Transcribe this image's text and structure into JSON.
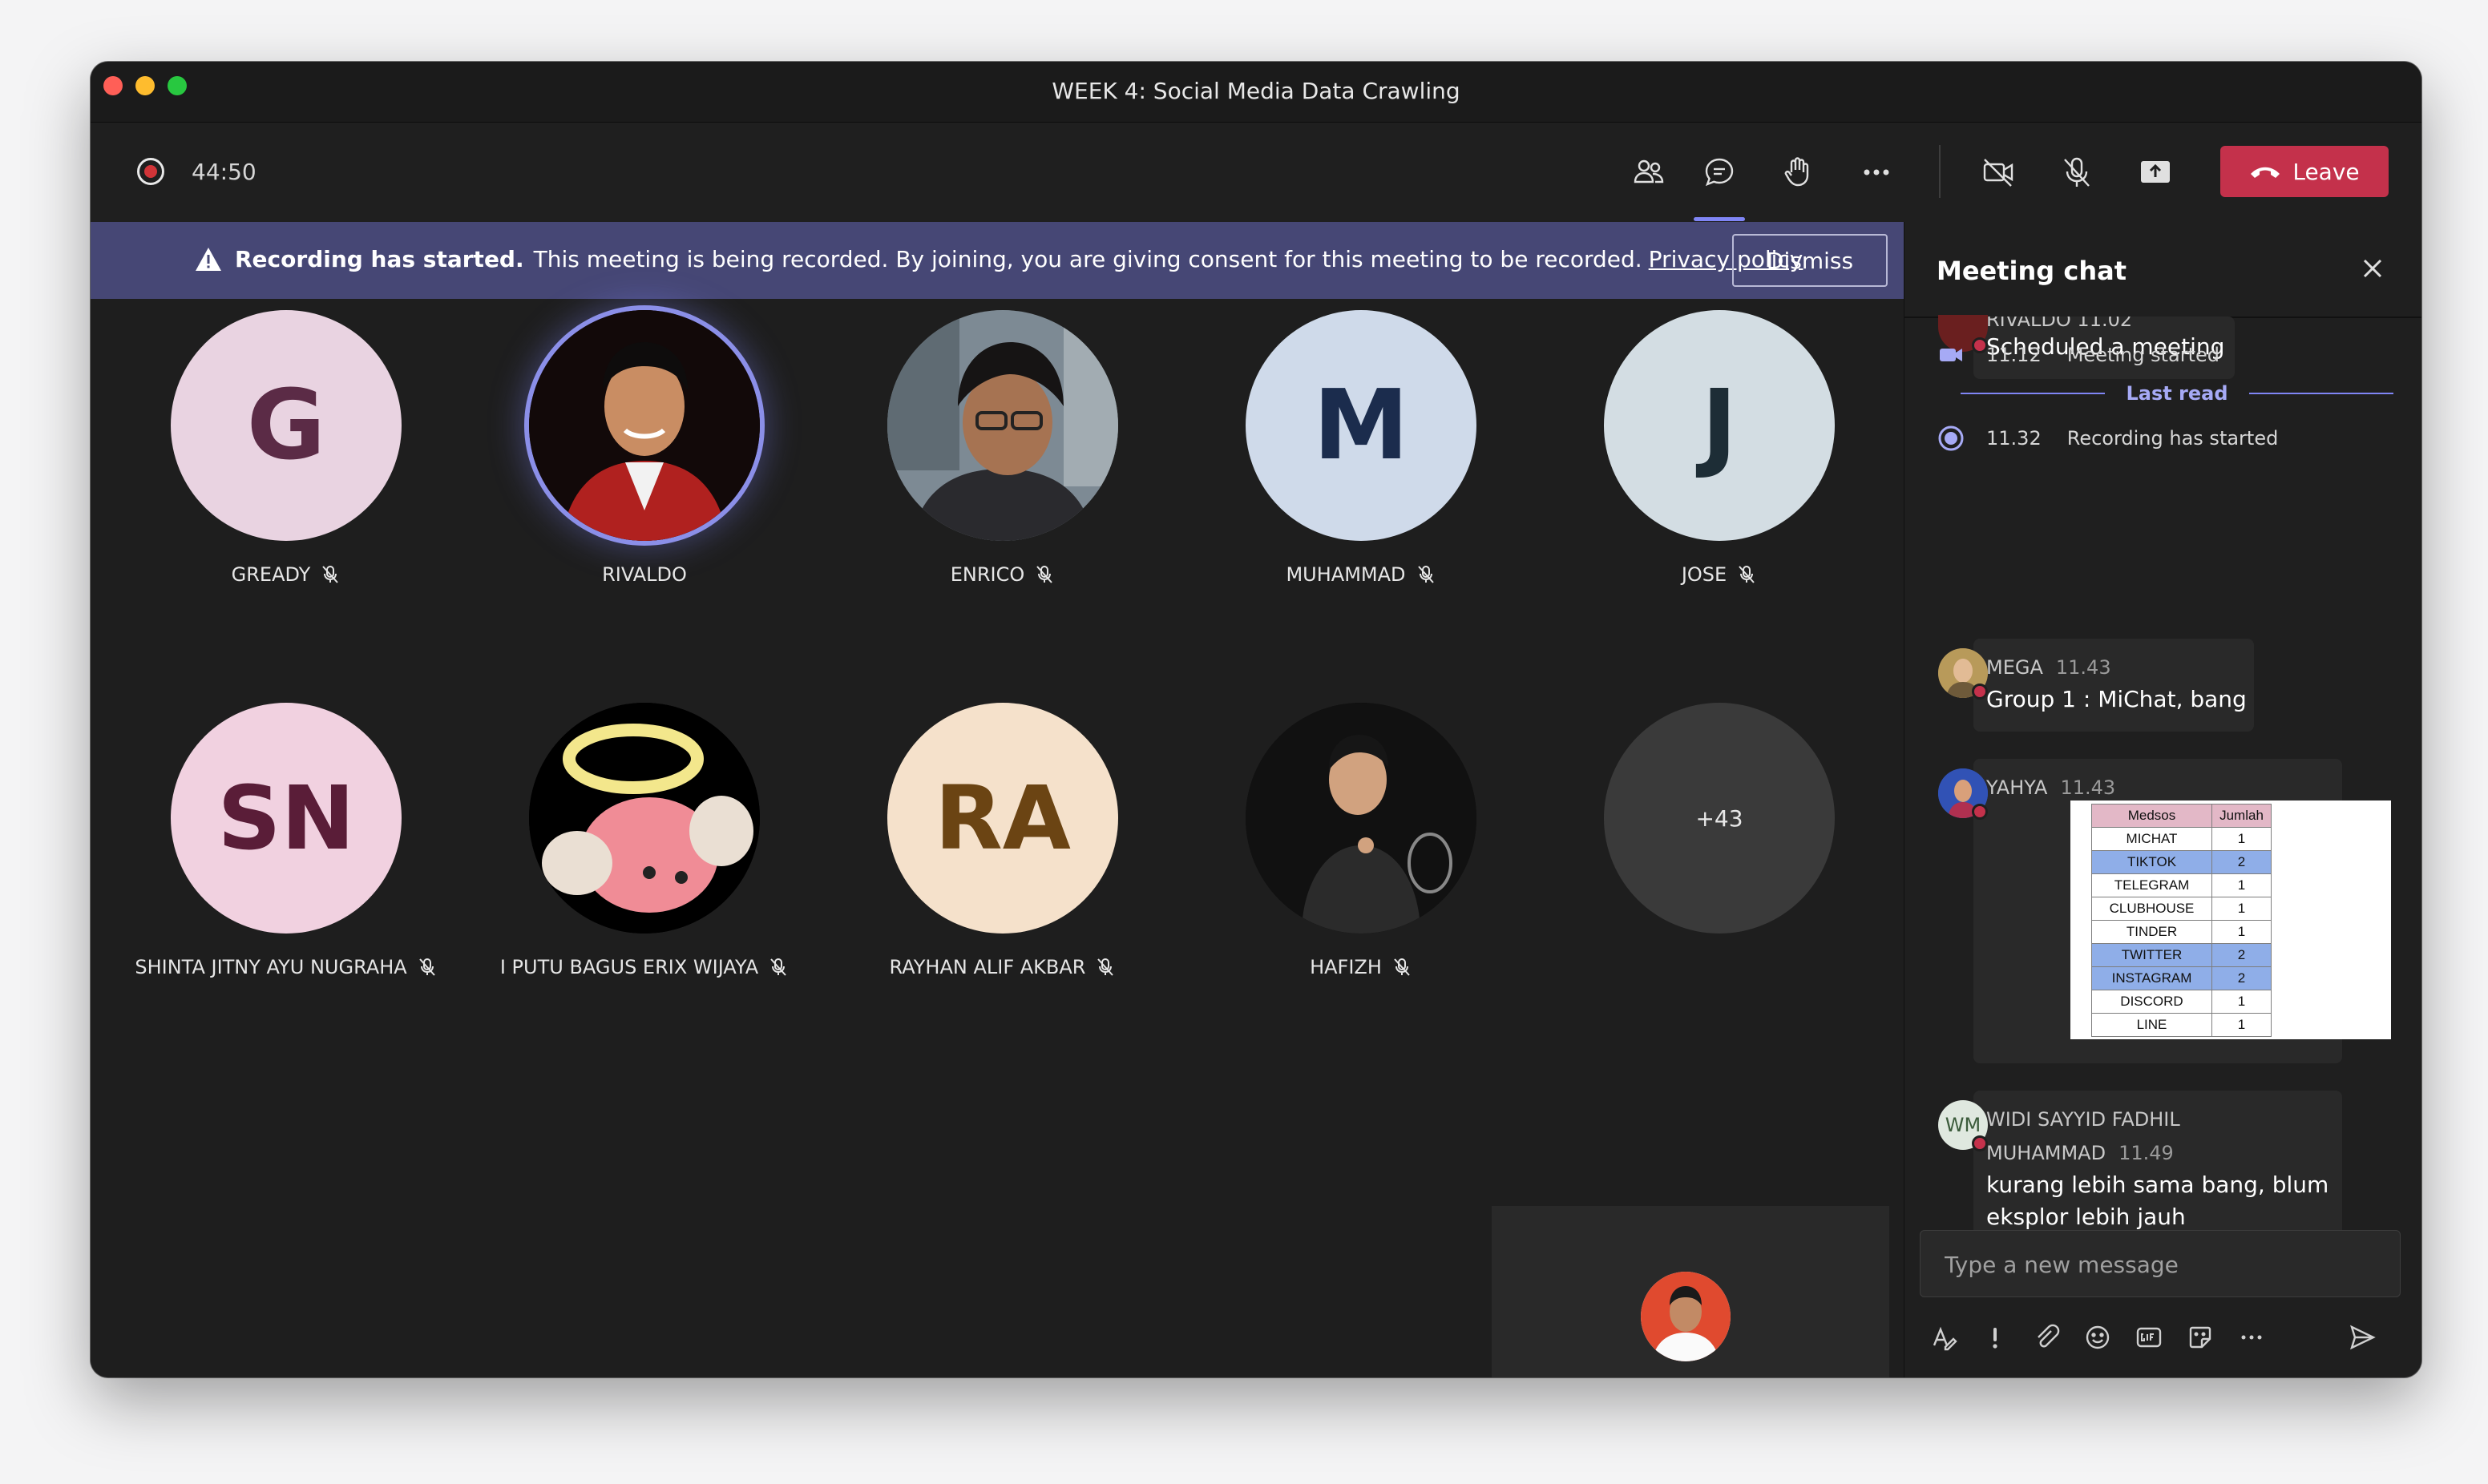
{
  "window": {
    "title": "WEEK 4: Social Media Data Crawling"
  },
  "toolbar": {
    "timer": "44:50",
    "leave_label": "Leave"
  },
  "banner": {
    "bold": "Recording has started.",
    "text": "This meeting is being recorded. By joining, you are giving consent for this meeting to be recorded.",
    "link": "Privacy policy",
    "dismiss": "Dismiss"
  },
  "participants": [
    {
      "name": "GREADY",
      "initials": "G",
      "bg": "#e9d3e1",
      "fg": "#5b2b46",
      "muted": true
    },
    {
      "name": "RIVALDO",
      "photo": true,
      "speaking": true,
      "muted": false
    },
    {
      "name": "ENRICO",
      "photo": true,
      "muted": true
    },
    {
      "name": "MUHAMMAD",
      "initials": "M",
      "bg": "#cfdaea",
      "fg": "#1b2c4d",
      "muted": true
    },
    {
      "name": "JOSE",
      "initials": "J",
      "bg": "#d3dde3",
      "fg": "#1d2d36",
      "muted": true
    },
    {
      "name": "SHINTA JITNY AYU NUGRAHA",
      "initials": "SN",
      "bg": "#f1d1e0",
      "fg": "#5a1d38",
      "muted": true
    },
    {
      "name": "I PUTU BAGUS ERIX WIJAYA",
      "photo": true,
      "muted": true
    },
    {
      "name": "RAYHAN ALIF AKBAR",
      "initials": "RA",
      "bg": "#f5e1cb",
      "fg": "#6b4413",
      "muted": true
    },
    {
      "name": "HAFIZH",
      "photo": true,
      "muted": true
    }
  ],
  "overflow_count": "+43",
  "chat": {
    "title": "Meeting chat",
    "first": {
      "meta": "RIVALDO   11.02",
      "text": "Scheduled a meeting"
    },
    "system": [
      {
        "time": "11.12",
        "text": "Meeting started"
      },
      {
        "time": "11.32",
        "text": "Recording has started"
      }
    ],
    "last_read": "Last read",
    "messages": [
      {
        "sender": "MEGA",
        "time": "11.43",
        "text": "Group 1 : MiChat, bang"
      },
      {
        "sender": "YAHYA",
        "time": "11.43"
      },
      {
        "sender_line1": "WIDI SAYYID FADHIL",
        "sender_line2": "MUHAMMAD",
        "time": "11.49",
        "initials": "WM",
        "text_line1": "kurang lebih sama bang, blum",
        "text_line2": "eksplor lebih jauh"
      }
    ],
    "table": {
      "headers": [
        "Medsos",
        "Jumlah"
      ],
      "rows": [
        [
          "MICHAT",
          "1"
        ],
        [
          "TIKTOK",
          "2"
        ],
        [
          "TELEGRAM",
          "1"
        ],
        [
          "CLUBHOUSE",
          "1"
        ],
        [
          "TINDER",
          "1"
        ],
        [
          "TWITTER",
          "2"
        ],
        [
          "INSTAGRAM",
          "2"
        ],
        [
          "DISCORD",
          "1"
        ],
        [
          "LINE",
          "1"
        ]
      ]
    },
    "composer_placeholder": "Type a new message"
  },
  "colors": {
    "accent": "#7f85f5",
    "leave": "#c4314b",
    "banner": "#464775"
  }
}
